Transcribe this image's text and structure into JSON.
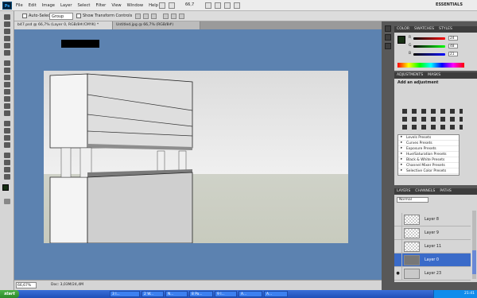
{
  "menubar": {
    "app_logo": "Ps",
    "menus": [
      "File",
      "Edit",
      "Image",
      "Layer",
      "Select",
      "Filter",
      "View",
      "Window",
      "Help"
    ],
    "zoom": "66,7",
    "workspace": "ESSENTIALS"
  },
  "options": {
    "auto_select_label": "Auto-Select:",
    "auto_select_value": "Group",
    "show_transform_label": "Show Transform Controls"
  },
  "tabs": [
    {
      "label": "b47.psd @ 66,7% (Layer 0, RGB/8#/CMYK) *"
    },
    {
      "label": "Untitled.jpg @ 66,7% (RGB/8#)"
    }
  ],
  "status": {
    "zoom": "66,67%",
    "doc": "Doc: 3,03M/24,4M"
  },
  "color_panel": {
    "tabs": [
      "COLOR",
      "SWATCHES",
      "STYLES"
    ],
    "channels": [
      {
        "label": "R",
        "value": "24"
      },
      {
        "label": "G",
        "value": "48"
      },
      {
        "label": "B",
        "value": "21"
      }
    ],
    "fg_color": "#183015"
  },
  "adjustments_panel": {
    "tabs": [
      "ADJUSTMENTS",
      "MASKS"
    ],
    "title": "Add an adjustment",
    "presets": [
      "Levels Presets",
      "Curves Presets",
      "Exposure Presets",
      "Hue/Saturation Presets",
      "Black & White Presets",
      "Channel Mixer Presets",
      "Selective Color Presets"
    ]
  },
  "layers_panel": {
    "tabs": [
      "LAYERS",
      "CHANNELS",
      "PATHS"
    ],
    "blend_mode": "Normal",
    "layers": [
      {
        "name": "Layer 8",
        "selected": false,
        "visible": false
      },
      {
        "name": "Layer 9",
        "selected": false,
        "visible": false
      },
      {
        "name": "Layer 11",
        "selected": false,
        "visible": false
      },
      {
        "name": "Layer 0",
        "selected": true,
        "visible": false
      },
      {
        "name": "Layer 23",
        "selected": false,
        "visible": true
      }
    ]
  },
  "taskbar": {
    "start": "start",
    "tasks": [
      "3 I...",
      "2 W...",
      "N...",
      "8 Pa...",
      "9 I...",
      "A...",
      "A..."
    ],
    "clock": "21:41"
  },
  "colors": {
    "canvas_bg": "#5c82b0",
    "selected_layer": "#3a6bc9"
  }
}
